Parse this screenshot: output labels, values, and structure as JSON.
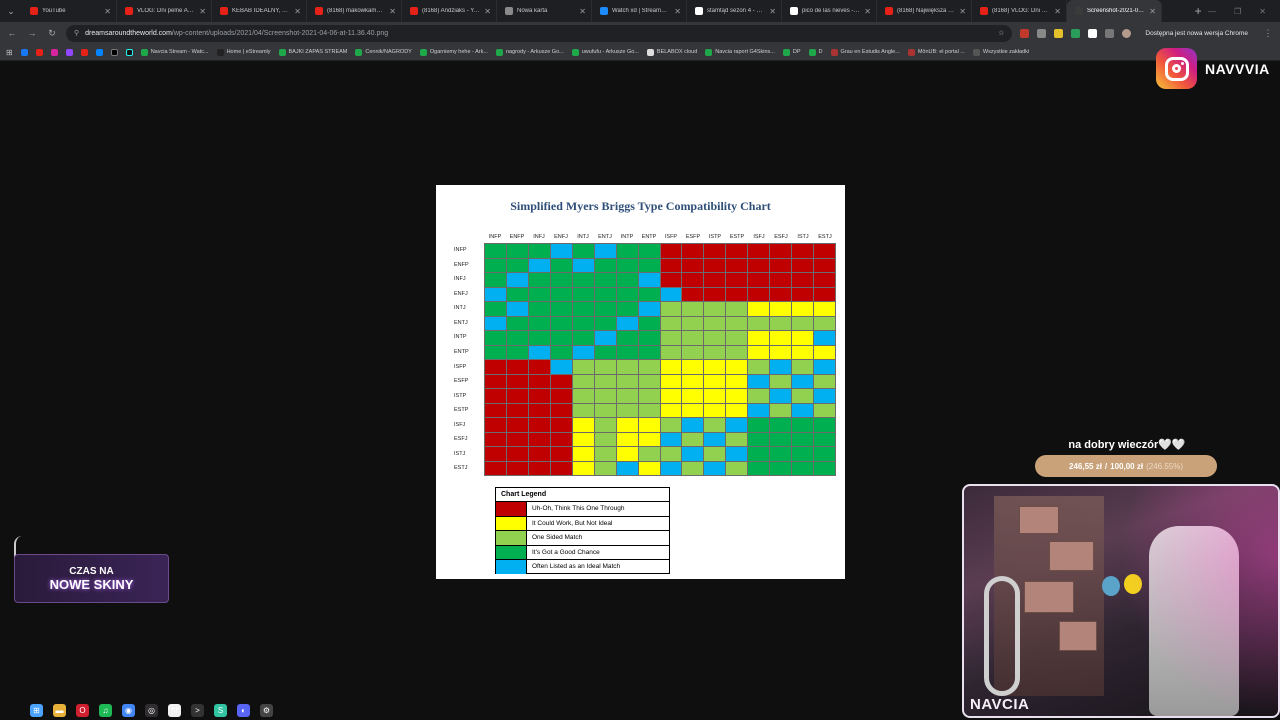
{
  "browser": {
    "tabs": [
      {
        "title": "YouTube",
        "icon": "youtube-icon",
        "color": "#e62117"
      },
      {
        "title": "VLOG: Dni pelne AKC...",
        "icon": "youtube-icon",
        "color": "#e62117"
      },
      {
        "title": "KEBAB IDEALNY, ale n...",
        "icon": "youtube-icon",
        "color": "#e62117"
      },
      {
        "title": "(8168) makowkamusi...",
        "icon": "youtube-icon",
        "color": "#e62117"
      },
      {
        "title": "(8168) Andziaks - You...",
        "icon": "youtube-icon",
        "color": "#e62117"
      },
      {
        "title": "Nowa karta",
        "icon": "chrome-icon",
        "color": "#8a8a8a"
      },
      {
        "title": "Watch xd | Streamable",
        "icon": "streamable-icon",
        "color": "#1a8cff"
      },
      {
        "title": "stamtąd sezon 4 - Sz...",
        "icon": "google-icon",
        "color": "#ffffff"
      },
      {
        "title": "pico de las nieves - Sz...",
        "icon": "google-icon",
        "color": "#ffffff"
      },
      {
        "title": "(8168) Największa PAF...",
        "icon": "youtube-icon",
        "color": "#e62117"
      },
      {
        "title": "(8168) VLOG: Dni pełn...",
        "icon": "youtube-icon",
        "color": "#e62117"
      },
      {
        "title": "Screenshot-2021-04-0...",
        "icon": "image-icon",
        "color": "#3b3b3b",
        "active": true
      }
    ],
    "url_host": "dreamsaroundtheworld.com",
    "url_path": "/wp-content/uploads/2021/04/Screenshot-2021-04-06-at-11.36.40.png",
    "update_label": "Dostępna jest nowa wersja Chrome",
    "bookmarks": [
      {
        "label": "Navcia Stream - Watc...",
        "color": "#1fa84a"
      },
      {
        "label": "Home | eStreamly",
        "color": "#222222"
      },
      {
        "label": "BAJKI ZAPAS STREAM",
        "color": "#1fa84a"
      },
      {
        "label": "Cennik/NAGRODY",
        "color": "#1fa84a"
      },
      {
        "label": "Ogarniemy hehe - Ark...",
        "color": "#1fa84a"
      },
      {
        "label": "nagrody - Arkusze Go...",
        "color": "#1fa84a"
      },
      {
        "label": "uwufufu - Arkusze Go...",
        "color": "#1fa84a"
      },
      {
        "label": "BELABOX cloud",
        "color": "#dddddd"
      },
      {
        "label": "Navcia raport G4Skins...",
        "color": "#1fa84a"
      },
      {
        "label": "DP",
        "color": "#1fa84a"
      },
      {
        "label": "D",
        "color": "#1fa84a"
      },
      {
        "label": "Grau en Estudis Angle...",
        "color": "#aa3333"
      },
      {
        "label": "MônUB: el portal ...",
        "color": "#aa3333"
      },
      {
        "label": "Wszystkie zakładki",
        "color": "#555555"
      }
    ]
  },
  "instagram": {
    "handle": "NAVVVIA"
  },
  "image": {
    "title": "Simplified Myers Briggs Type Compatibility Chart",
    "types": [
      "INFP",
      "ENFP",
      "INFJ",
      "ENFJ",
      "INTJ",
      "ENTJ",
      "INTP",
      "ENTP",
      "ISFP",
      "ESFP",
      "ISTP",
      "ESTP",
      "ISFJ",
      "ESFJ",
      "ISTJ",
      "ESTJ"
    ],
    "colors": {
      "R": "#c00000",
      "Y": "#ffff00",
      "L": "#92d050",
      "G": "#00b050",
      "B": "#00b0f0"
    },
    "matrix": [
      "GGGBGBGGRRRRRRRR",
      "GGBGBGGGRRRRRRRR",
      "GBGGGGGBRRRRRRRR",
      "BGGGGGGGBRRRRRRR",
      "GBGGGGGBLLLLYYYY",
      "BGGGGGBGLLLLLLLL",
      "GGGGGBGGLLLLYYYB",
      "GGBGBGGGLLLLYYYY",
      "RRRBLLLLYYYYLBLB",
      "RRRRLLLLYYYYBLBL",
      "RRRRLLLLYYYYLBLB",
      "RRRRLLLLYYYYBLBL",
      "RRRRYLYYLBLBGGGG",
      "RRRRYLYYBLBLGGGG",
      "RRRRYLYLLBLBGGGG",
      "RRRRYLBYBLBLGGGG"
    ],
    "legend_title": "Chart Legend",
    "legend": [
      {
        "key": "R",
        "label": "Uh-Oh, Think This One Through"
      },
      {
        "key": "Y",
        "label": "It Could Work, But Not Ideal"
      },
      {
        "key": "L",
        "label": "One Sided Match"
      },
      {
        "key": "G",
        "label": "It's Got a Good Chance"
      },
      {
        "key": "B",
        "label": "Often Listed as an Ideal Match"
      }
    ]
  },
  "overlay": {
    "skins_line1": "CZAS NA",
    "skins_line2": "NOWE SKINY",
    "greeting": "na dobry wieczór🤍🤍",
    "goal_current": "246,55 zł",
    "goal_sep": "/",
    "goal_target": "100,00 zł",
    "goal_pct": "(246.55%)",
    "goal_fill": 1.0,
    "cam_mark": "NAVCIA"
  },
  "taskbar": [
    {
      "icon": "start-icon",
      "color": "#4aa3ff",
      "glyph": "⊞"
    },
    {
      "icon": "folder-icon",
      "color": "#e8b23a",
      "glyph": "▬"
    },
    {
      "icon": "opera-icon",
      "color": "#d01f2f",
      "glyph": "O"
    },
    {
      "icon": "spotify-icon",
      "color": "#1db954",
      "glyph": "♫"
    },
    {
      "icon": "chrome-icon",
      "color": "#4285f4",
      "glyph": "◉"
    },
    {
      "icon": "obs-icon",
      "color": "#302e31",
      "glyph": "◎"
    },
    {
      "icon": "notion-icon",
      "color": "#f2f2f2",
      "glyph": "N"
    },
    {
      "icon": "terminal-icon",
      "color": "#333333",
      "glyph": ">"
    },
    {
      "icon": "streamlabs-icon",
      "color": "#31c3a2",
      "glyph": "S"
    },
    {
      "icon": "discord-icon",
      "color": "#5865f2",
      "glyph": "◐"
    },
    {
      "icon": "settings-icon",
      "color": "#444444",
      "glyph": "⚙"
    }
  ]
}
